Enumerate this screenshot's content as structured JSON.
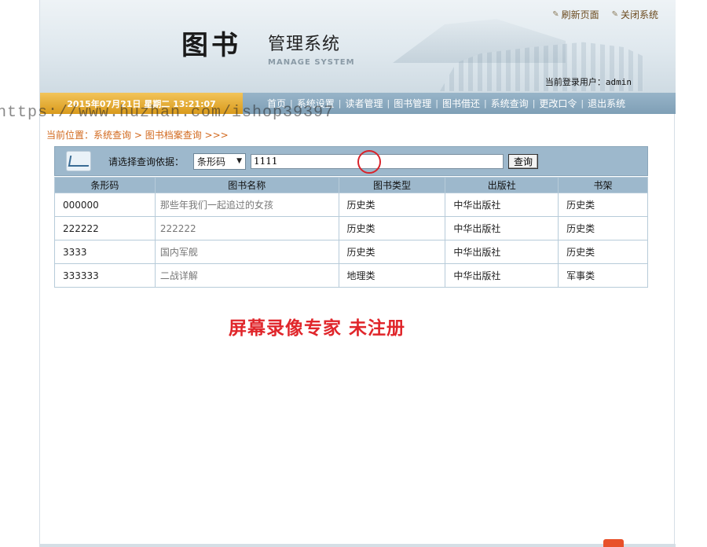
{
  "header": {
    "logo_main": "图书",
    "logo_sub": "管理系统",
    "logo_en": "MANAGE SYSTEM",
    "refresh_label": "刷新页面",
    "close_label": "关闭系统",
    "login_prefix": "当前登录用户：",
    "login_user": "admin"
  },
  "nav": {
    "datetime": "2015年07月21日 星期二 13:21:07",
    "items": [
      {
        "label": "首页"
      },
      {
        "label": "系统设置"
      },
      {
        "label": "读者管理"
      },
      {
        "label": "图书管理"
      },
      {
        "label": "图书借还"
      },
      {
        "label": "系统查询"
      },
      {
        "label": "更改口令"
      },
      {
        "label": "退出系统"
      }
    ]
  },
  "watermark_url": "https://www.huzhan.com/ishop39397",
  "breadcrumb": {
    "prefix": "当前位置：",
    "level1": "系统查询",
    "sep": " > ",
    "level2": "图书档案查询",
    "tail": " >>>"
  },
  "search": {
    "label": "请选择查询依据：",
    "select_value": "条形码",
    "input_value": "1111",
    "button_label": "查询"
  },
  "table": {
    "headers": [
      "条形码",
      "图书名称",
      "图书类型",
      "出版社",
      "书架"
    ],
    "rows": [
      [
        "000000",
        "那些年我们一起追过的女孩",
        "历史类",
        "中华出版社",
        "历史类"
      ],
      [
        "222222",
        "222222",
        "历史类",
        "中华出版社",
        "历史类"
      ],
      [
        "3333",
        "国内军舰",
        "历史类",
        "中华出版社",
        "历史类"
      ],
      [
        "333333",
        "二战详解",
        "地理类",
        "中华出版社",
        "军事类"
      ]
    ]
  },
  "overlay_text": "屏幕录像专家 未注册",
  "colors": {
    "nav_bg": "#8aa9bf",
    "date_bg": "#e3a92e",
    "accent_orange": "#d2691e",
    "unreg_red": "#e0262b"
  }
}
